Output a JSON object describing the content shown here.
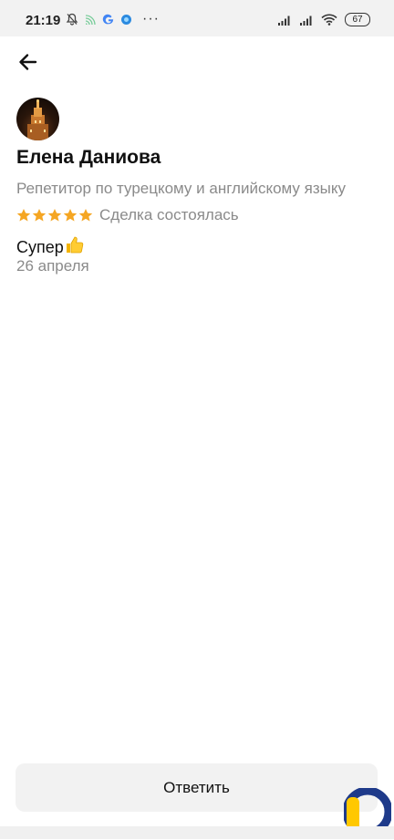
{
  "status_bar": {
    "time": "21:19",
    "dots": "···",
    "battery": "67"
  },
  "header": {
    "back_icon": "arrow-left-icon"
  },
  "review": {
    "name": "Елена Даниова",
    "subtitle": "Репетитор по турецкому и английскому языку",
    "rating": 5,
    "rating_max": 5,
    "deal_status": "Сделка состоялась",
    "text": "Супер",
    "text_emoji": "thumbs-up-icon",
    "date": "26 апреля"
  },
  "actions": {
    "reply_label": "Ответить"
  },
  "colors": {
    "star": "#f5a623",
    "secondary_text": "#8a8a8a",
    "button_bg": "#f2f2f2",
    "logo_yellow": "#ffc800",
    "logo_blue": "#1e3a8a"
  }
}
